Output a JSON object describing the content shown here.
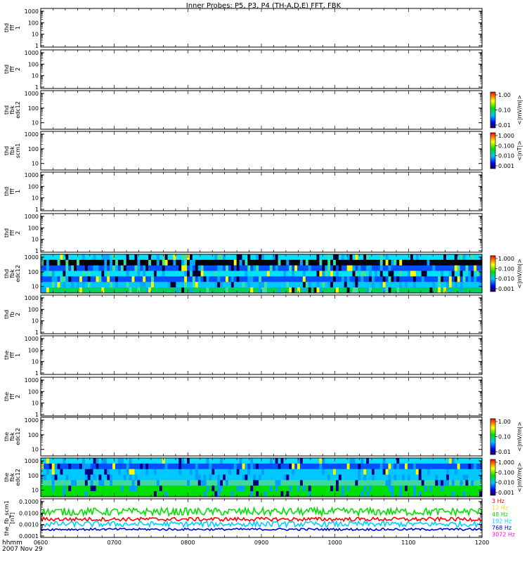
{
  "title": "Inner Probes: P5, P3, P4 (TH-A,D,E) FFT, FBK",
  "time_axis": {
    "row_label": "hhmm",
    "date_label": "2007 Nov 29",
    "ticks": [
      "0600",
      "0700",
      "0800",
      "0900",
      "1000",
      "1100",
      "1200"
    ]
  },
  "panels": [
    {
      "label": [
        "thd",
        "fff",
        "1"
      ],
      "type": "empty",
      "yticks": [
        "1000",
        "100",
        "10",
        "1"
      ]
    },
    {
      "label": [
        "thd",
        "fff",
        "2"
      ],
      "type": "empty",
      "yticks": [
        "1000",
        "100",
        "10",
        "1"
      ]
    },
    {
      "label": [
        "thd",
        "fbk",
        "edc12"
      ],
      "type": "empty",
      "yticks": [
        "1000",
        "100",
        "10"
      ],
      "colorbar": {
        "ticks": [
          "1.00",
          "0.10",
          "0.01"
        ],
        "label": "<|mV/m|>"
      }
    },
    {
      "label": [
        "thd",
        "fbk",
        "scm1"
      ],
      "type": "empty",
      "yticks": [
        "1000",
        "100",
        "10"
      ],
      "colorbar": {
        "ticks": [
          "1.000",
          "0.100",
          "0.010",
          "0.001"
        ],
        "label": "<|nT|>"
      }
    },
    {
      "label": [
        "thd",
        "fff",
        "1"
      ],
      "type": "empty",
      "yticks": [
        "1000",
        "100",
        "10",
        "1"
      ]
    },
    {
      "label": [
        "thd",
        "fff",
        "2"
      ],
      "type": "empty",
      "yticks": [
        "1000",
        "100",
        "10",
        "1"
      ]
    },
    {
      "label": [
        "thd",
        "fbk",
        "edc12"
      ],
      "type": "spectrogram",
      "yticks": [
        "1000",
        "100",
        "10"
      ],
      "colorbar": {
        "ticks": [
          "1.000",
          "0.100",
          "0.010",
          "0.001"
        ],
        "label": "<|mV/m|>"
      }
    },
    {
      "label": [
        "thd",
        "fb",
        "2"
      ],
      "type": "empty",
      "yticks": [
        "1000",
        "100",
        "10",
        "1"
      ]
    },
    {
      "label": [
        "the",
        "fff",
        "1"
      ],
      "type": "empty",
      "yticks": [
        "1000",
        "100",
        "10",
        "1"
      ]
    },
    {
      "label": [
        "the",
        "fff",
        "2"
      ],
      "type": "empty",
      "yticks": [
        "1000",
        "100",
        "10",
        "1"
      ]
    },
    {
      "label": [
        "the",
        "fbk",
        "edc12"
      ],
      "type": "empty",
      "yticks": [
        "1000",
        "100",
        "10"
      ],
      "colorbar": {
        "ticks": [
          "1.00",
          "0.10",
          "0.01"
        ],
        "label": "<|mV/m|>"
      }
    },
    {
      "label": [
        "the",
        "fbk",
        "edc12"
      ],
      "type": "spectrogram",
      "yticks": [
        "1000",
        "100",
        "10"
      ],
      "colorbar": {
        "ticks": [
          "1.000",
          "0.100",
          "0.010",
          "0.001"
        ],
        "label": "<|mV/m|>"
      }
    },
    {
      "label": [
        "the_fb_scm1",
        "[nT]"
      ],
      "type": "lineplot",
      "yticks": [
        "0.1000",
        "0.0100",
        "0.0010",
        "0.0001"
      ]
    }
  ],
  "chart_data": {
    "type": "line",
    "title": "Inner Probes: P5, P3, P4 (TH-A,D,E) FFT, FBK",
    "x_range": [
      "0600",
      "1200"
    ],
    "ylabel": "[nT]",
    "ylim": [
      0.0001,
      0.1
    ],
    "y_scale": "log",
    "series": [
      {
        "name": "3 Hz",
        "color": "#ff0000"
      },
      {
        "name": "12 Hz",
        "color": "#ffd700"
      },
      {
        "name": "48 Hz",
        "color": "#00e000"
      },
      {
        "name": "192 Hz",
        "color": "#00d0ff"
      },
      {
        "name": "768 Hz",
        "color": "#0000cc"
      },
      {
        "name": "3072 Hz",
        "color": "#ff00ff"
      }
    ]
  }
}
